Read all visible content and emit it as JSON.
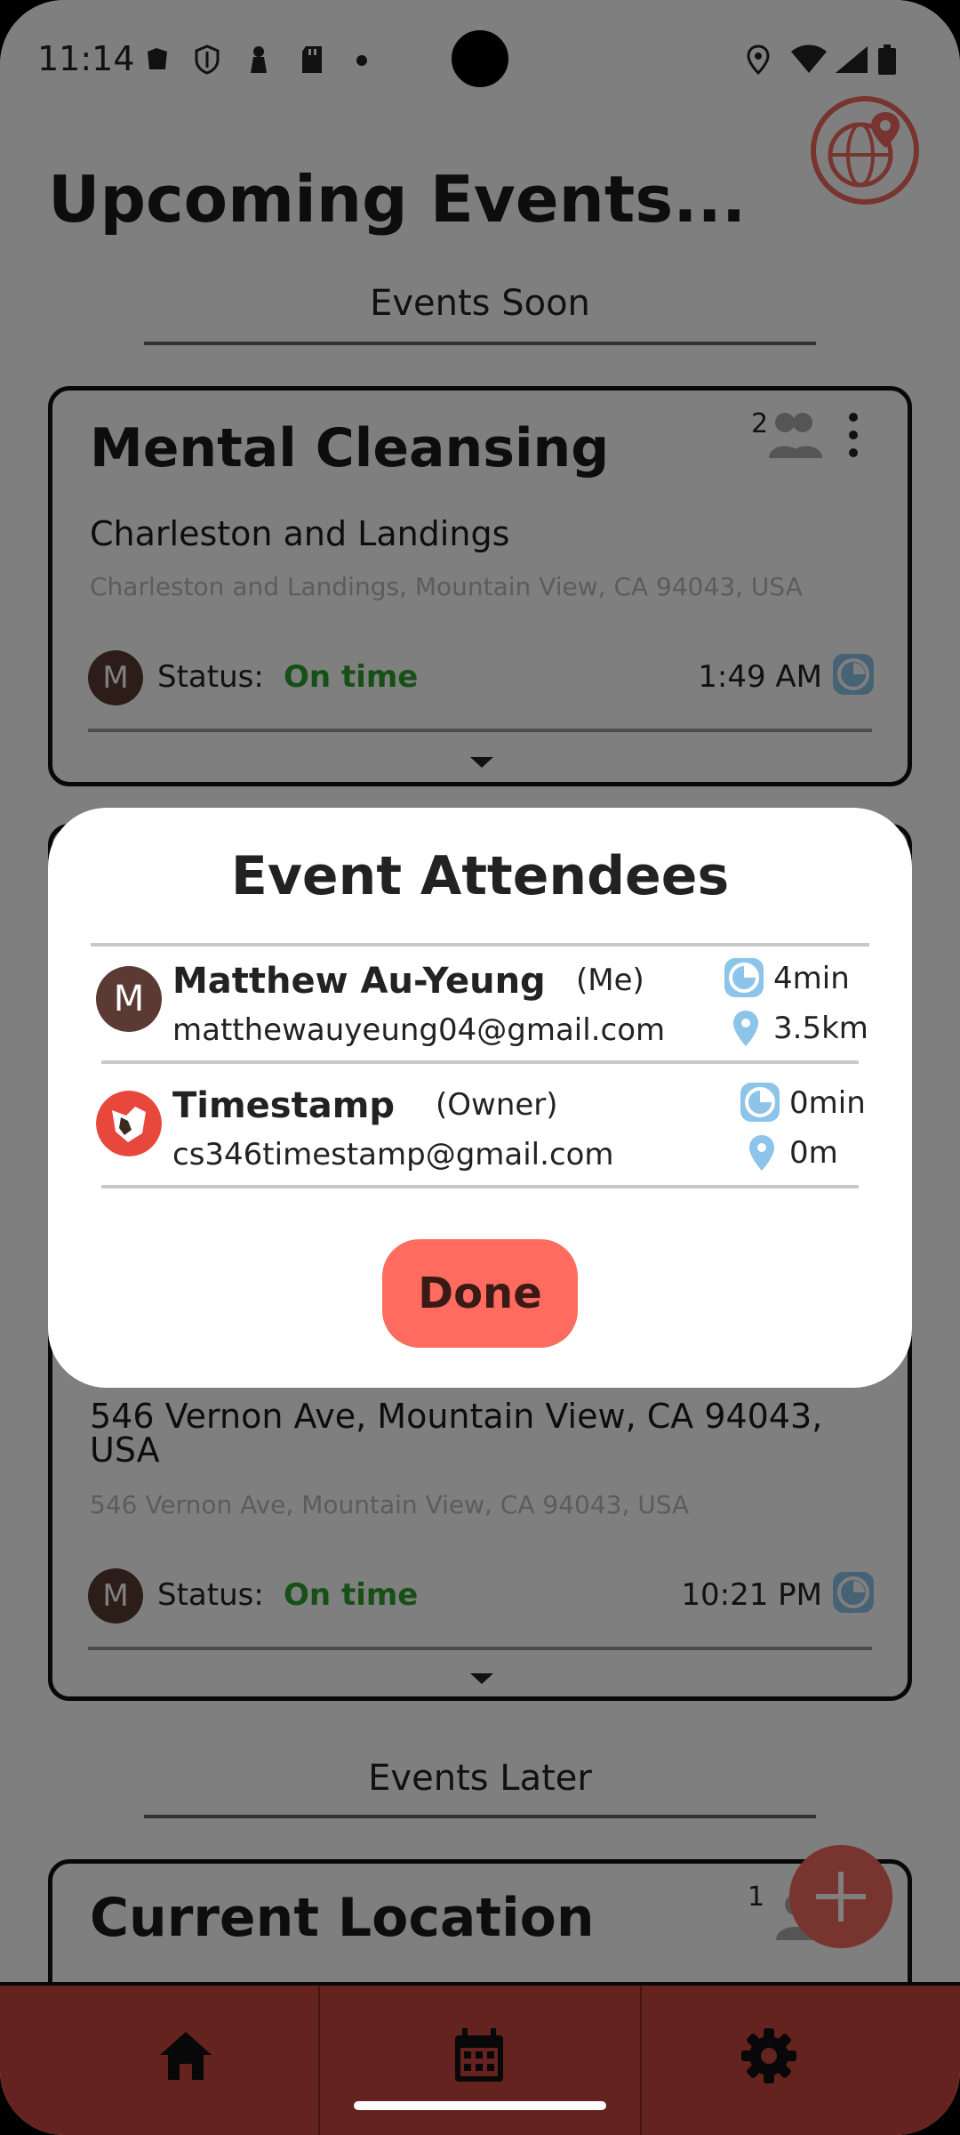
{
  "status_bar": {
    "time": "11:14"
  },
  "page": {
    "title": "Upcoming Events...",
    "section_soon": "Events Soon",
    "section_later": "Events Later"
  },
  "events": [
    {
      "title": "Mental Cleansing",
      "place": "Charleston and Landings",
      "address": "Charleston and Landings, Mountain View, CA 94043, USA",
      "avatar_letter": "M",
      "status_label": "Status:",
      "status_value": "On time",
      "time": "1:49 AM",
      "attendee_count": "2"
    },
    {
      "place": "546 Vernon Ave, Mountain View, CA 94043, USA",
      "address": "546 Vernon Ave, Mountain View, CA 94043, USA",
      "avatar_letter": "M",
      "status_label": "Status:",
      "status_value": "On time",
      "time": "10:21 PM"
    },
    {
      "title": "Current Location",
      "attendee_count": "1"
    }
  ],
  "dialog": {
    "title": "Event Attendees",
    "attendees": [
      {
        "avatar_letter": "M",
        "name": "Matthew Au-Yeung",
        "role": "(Me)",
        "email": "matthewauyeung04@gmail.com",
        "eta": "4min",
        "distance": "3.5km"
      },
      {
        "name": "Timestamp",
        "role": "(Owner)",
        "email": "cs346timestamp@gmail.com",
        "eta": "0min",
        "distance": "0m"
      }
    ],
    "done_label": "Done"
  },
  "colors": {
    "accent": "#ff6b5e",
    "nav_bar": "#c9463c",
    "status_ok": "#2ea02e",
    "clock_icon": "#8cc4ea"
  }
}
